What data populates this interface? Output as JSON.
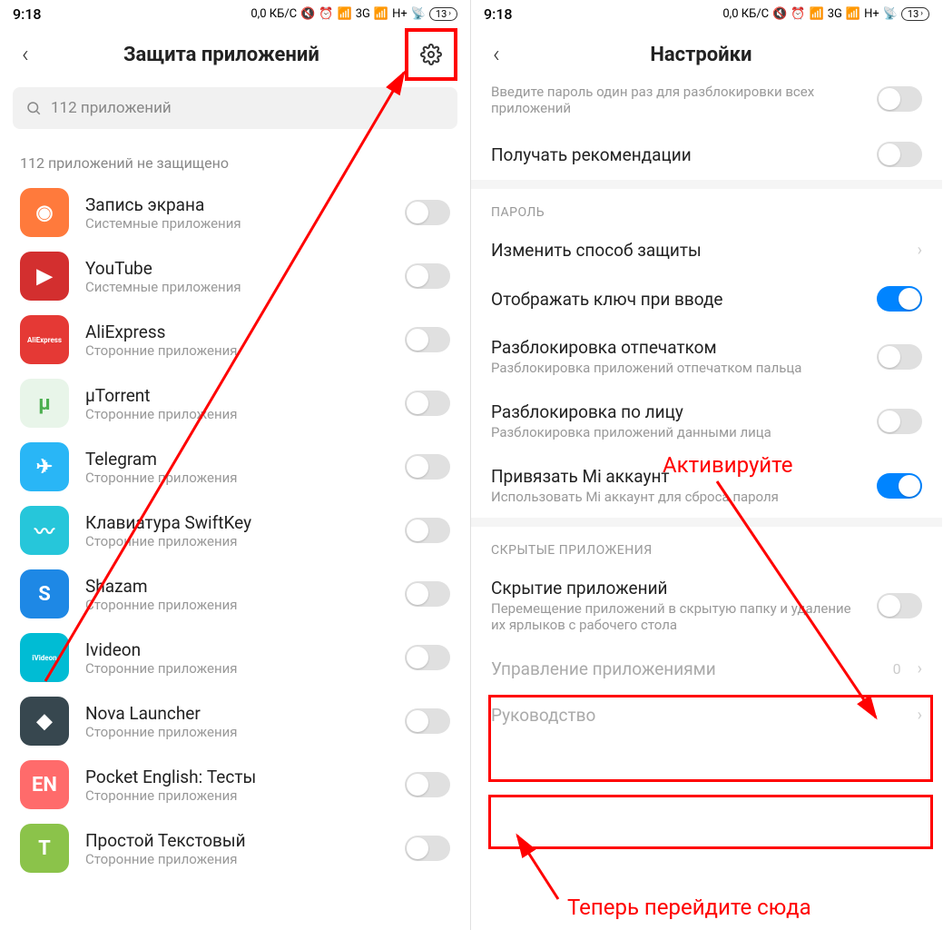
{
  "status": {
    "time": "9:18",
    "net": "0,0 КБ/С",
    "sig1": "3G",
    "sig2": "H+",
    "battery": "13"
  },
  "left": {
    "title": "Защита приложений",
    "search_placeholder": "112 приложений",
    "section": "112 приложений не защищено",
    "apps": [
      {
        "name": "Запись экрана",
        "sub": "Системные приложения",
        "color": "#ff7a3c",
        "glyph": "◉"
      },
      {
        "name": "YouTube",
        "sub": "Системные приложения",
        "color": "#d32f2f",
        "glyph": "▶"
      },
      {
        "name": "AliExpress",
        "sub": "Сторонние приложения",
        "color": "#e53935",
        "glyph": "AliExpress"
      },
      {
        "name": "µTorrent",
        "sub": "Сторонние приложения",
        "color": "#e8f5e9",
        "glyph": "µ"
      },
      {
        "name": "Telegram",
        "sub": "Сторонние приложения",
        "color": "#29b6f6",
        "glyph": "✈"
      },
      {
        "name": "Клавиатура SwiftKey",
        "sub": "Сторонние приложения",
        "color": "#26c6da",
        "glyph": "〰"
      },
      {
        "name": "Shazam",
        "sub": "Сторонние приложения",
        "color": "#1e88e5",
        "glyph": "S"
      },
      {
        "name": "Ivideon",
        "sub": "Сторонние приложения",
        "color": "#00bcd4",
        "glyph": "iVideon"
      },
      {
        "name": "Nova Launcher",
        "sub": "Сторонние приложения",
        "color": "#37474f",
        "glyph": "◆"
      },
      {
        "name": "Pocket English: Тесты",
        "sub": "Сторонние приложения",
        "color": "#ff6b6b",
        "glyph": "EN"
      },
      {
        "name": "Простой Текстовый",
        "sub": "Сторонние приложения",
        "color": "#8bc34a",
        "glyph": "T"
      }
    ]
  },
  "right": {
    "title": "Настройки",
    "partial_sub": "Введите пароль один раз для разблокировки всех приложений",
    "rows": [
      {
        "title": "Получать рекомендации",
        "toggle": "off"
      }
    ],
    "password_section": "ПАРОЛЬ",
    "password_rows": [
      {
        "title": "Изменить способ защиты",
        "type": "link"
      },
      {
        "title": "Отображать ключ при вводе",
        "type": "toggle",
        "state": "on"
      },
      {
        "title": "Разблокировка отпечатком",
        "sub": "Разблокировка приложений отпечатком пальца",
        "type": "toggle",
        "state": "off"
      },
      {
        "title": "Разблокировка по лицу",
        "sub": "Разблокировка приложений данными лица",
        "type": "toggle",
        "state": "off"
      },
      {
        "title": "Привязать Mi аккаунт",
        "sub": "Использовать Mi аккаунт для сброса пароля",
        "type": "toggle",
        "state": "on"
      }
    ],
    "hidden_section": "СКРЫТЫЕ ПРИЛОЖЕНИЯ",
    "hidden_rows": [
      {
        "title": "Скрытие приложений",
        "sub": "Перемещение приложений в скрытую папку и удаление их ярлыков с рабочего стола",
        "type": "toggle",
        "state": "off"
      },
      {
        "title": "Управление приложениями",
        "count": "0",
        "type": "link",
        "dim": true
      },
      {
        "title": "Руководство",
        "type": "link",
        "dim": true
      }
    ]
  },
  "annotations": {
    "activate": "Активируйте",
    "goto": "Теперь перейдите сюда"
  }
}
